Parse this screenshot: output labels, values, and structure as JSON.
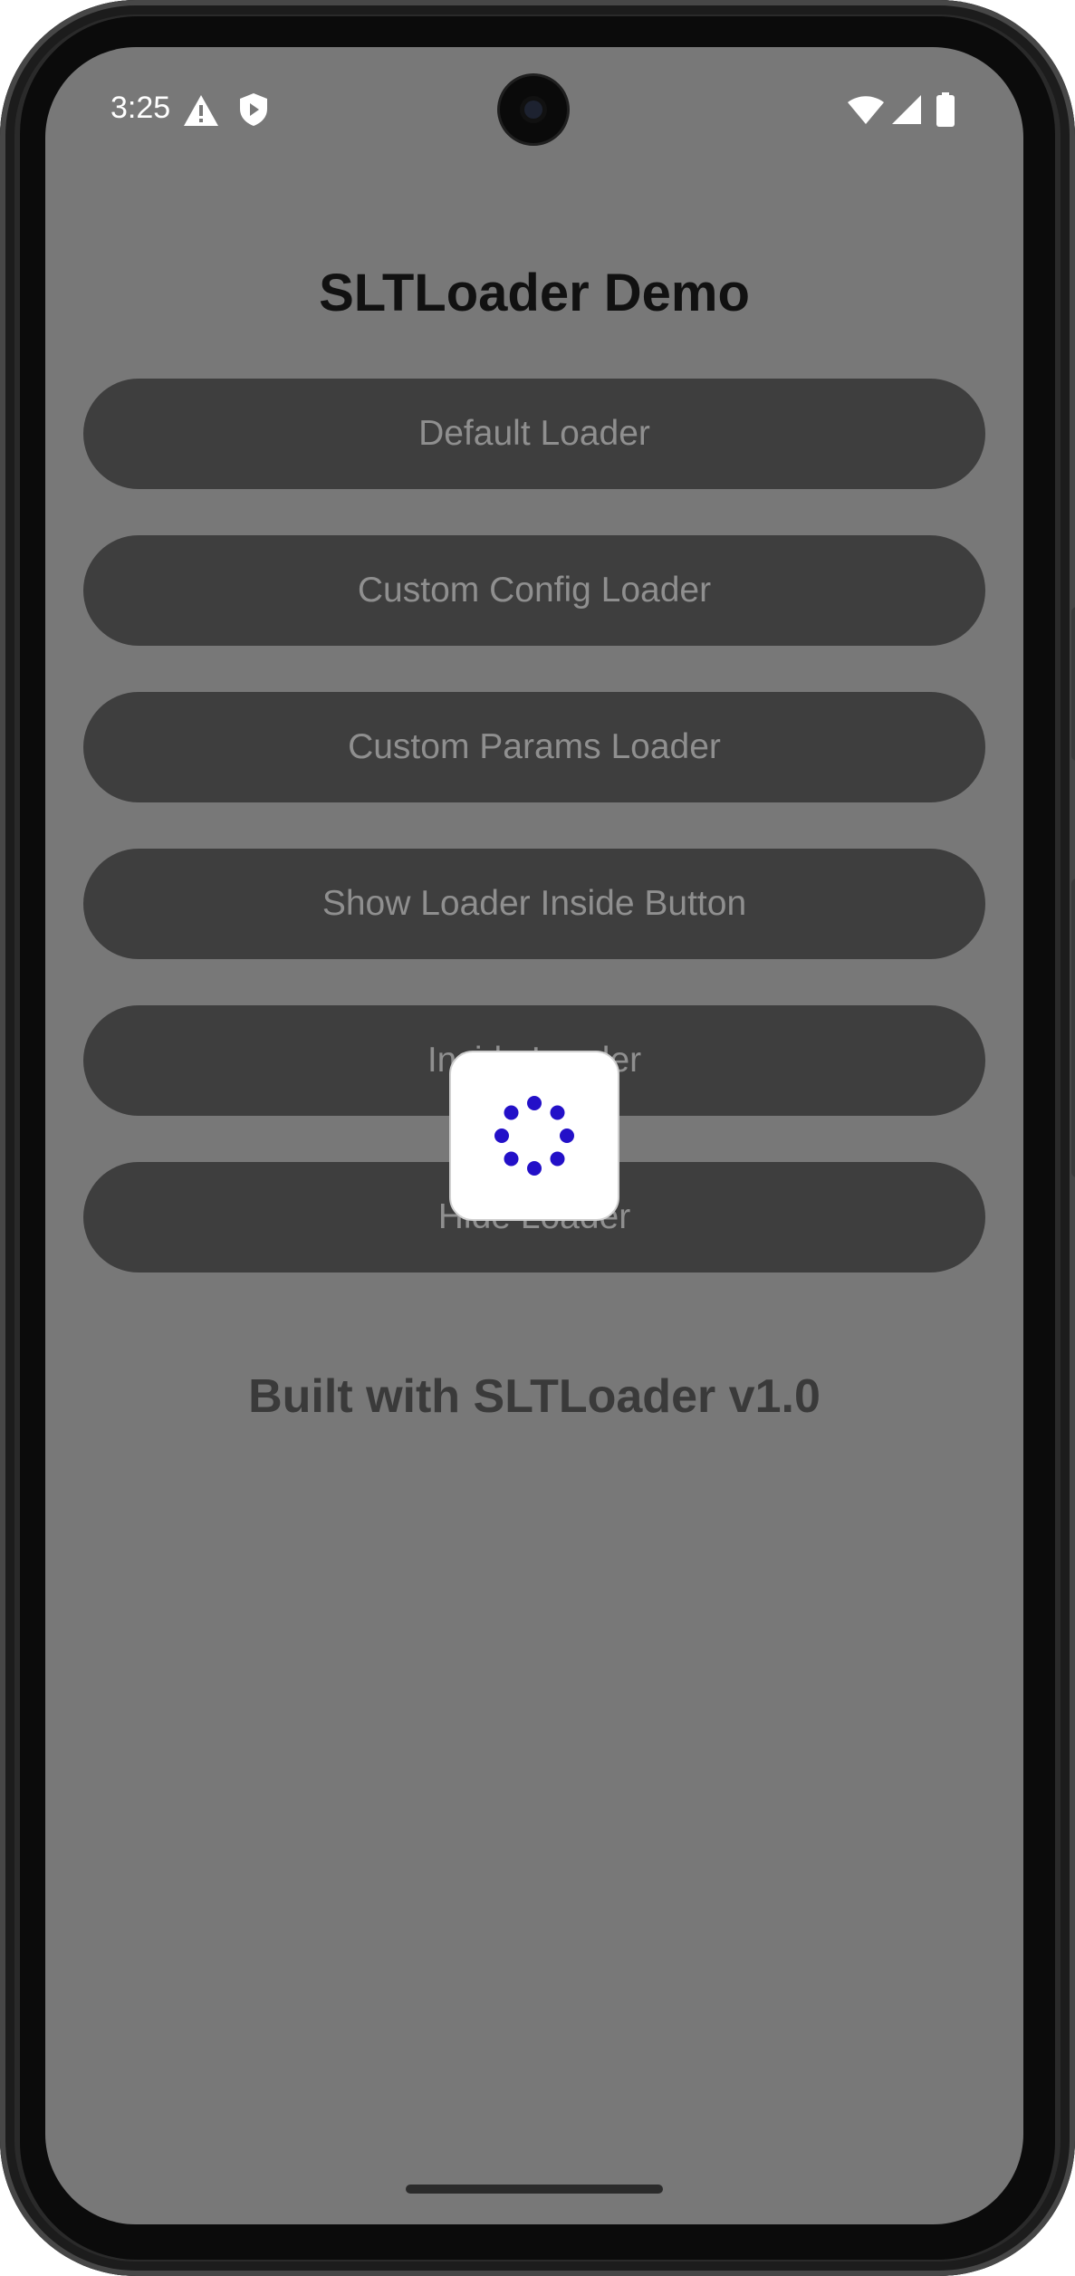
{
  "status_bar": {
    "time": "3:25",
    "left_icons": [
      "warning-icon",
      "shield-play-icon"
    ],
    "right_icons": [
      "wifi-icon",
      "cellular-signal-icon",
      "battery-icon"
    ]
  },
  "app": {
    "title": "SLTLoader Demo",
    "buttons": [
      {
        "label": "Default Loader"
      },
      {
        "label": "Custom Config Loader"
      },
      {
        "label": "Custom Params Loader"
      },
      {
        "label": "Show Loader Inside Button"
      },
      {
        "label": "Inside Loader"
      },
      {
        "label": "Hide Loader"
      }
    ],
    "footer": "Built with SLTLoader v1.0"
  },
  "loader": {
    "icon": "spinner-dots-icon",
    "dot_color": "#2310c8"
  },
  "colors": {
    "scrim_background": "#787878",
    "button_background": "#3e3e3e",
    "button_text": "#8f8f8f",
    "title_text": "#111111"
  }
}
